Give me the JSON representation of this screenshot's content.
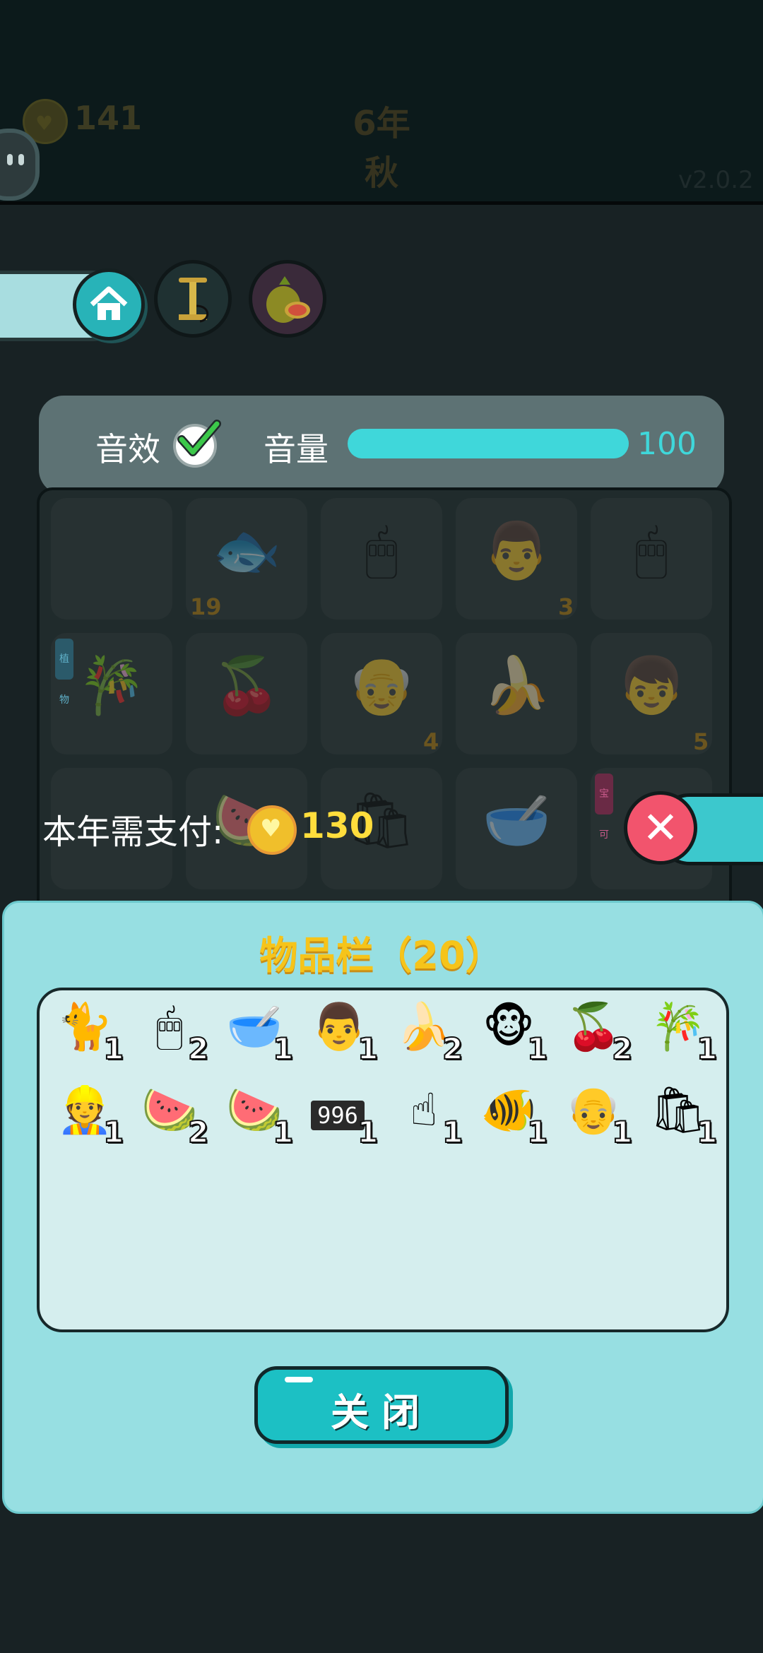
{
  "header": {
    "coins": "141",
    "year": "6年",
    "season": "秋",
    "version": "v2.0.2"
  },
  "toolbar": {
    "home_icon": "home-icon",
    "items": [
      "pump-icon",
      "pomelo-icon"
    ]
  },
  "settings": {
    "sound_label": "音效",
    "sound_enabled": true,
    "volume_label": "音量",
    "volume_value": "100",
    "volume_fraction": 1.0
  },
  "grid": {
    "cells": [
      {
        "icon": "",
        "count": ""
      },
      {
        "icon": "🐟",
        "count": "19"
      },
      {
        "icon": "🖱",
        "count": ""
      },
      {
        "icon": "👨",
        "count": "3"
      },
      {
        "icon": "🖱",
        "count": ""
      },
      {
        "icon": "🎋",
        "count": "",
        "tag": "植物"
      },
      {
        "icon": "🍒",
        "count": ""
      },
      {
        "icon": "👴",
        "count": "4"
      },
      {
        "icon": "🍌",
        "count": ""
      },
      {
        "icon": "👦",
        "count": "5"
      },
      {
        "icon": "",
        "count": ""
      },
      {
        "icon": "🍉",
        "count": ""
      },
      {
        "icon": "🛍",
        "count": ""
      },
      {
        "icon": "🥣",
        "count": ""
      },
      {
        "icon": "",
        "count": "",
        "tag": "宝可"
      }
    ]
  },
  "payment": {
    "label": "本年需支付:",
    "value": "130"
  },
  "inventory": {
    "title": "物品栏（20）",
    "items": [
      {
        "icon": "🐈",
        "count": "1"
      },
      {
        "icon": "🖱",
        "count": "2"
      },
      {
        "icon": "🥣",
        "count": "1"
      },
      {
        "icon": "👨",
        "count": "1"
      },
      {
        "icon": "🍌",
        "count": "2"
      },
      {
        "icon": "🐵",
        "count": "1"
      },
      {
        "icon": "🍒",
        "count": "2"
      },
      {
        "icon": "🎋",
        "count": "1"
      },
      {
        "icon": "👷",
        "count": "1"
      },
      {
        "icon": "🍉",
        "count": "2"
      },
      {
        "icon": "🍉",
        "count": "1"
      },
      {
        "icon": "996",
        "count": "1"
      },
      {
        "icon": "☝",
        "count": "1"
      },
      {
        "icon": "🐠",
        "count": "1"
      },
      {
        "icon": "👴",
        "count": "1"
      },
      {
        "icon": "🛍",
        "count": "1"
      }
    ],
    "close_label": "关闭"
  }
}
